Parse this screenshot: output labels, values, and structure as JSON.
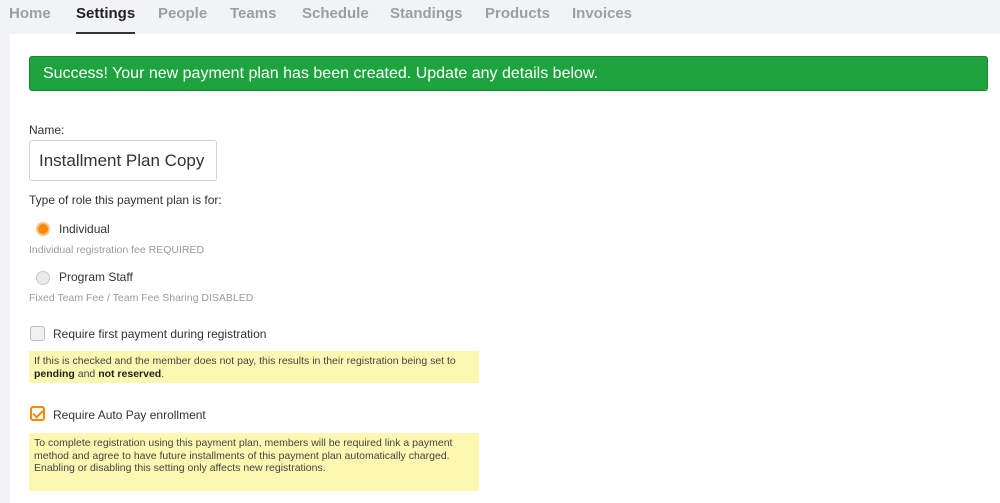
{
  "nav": {
    "tabs": [
      {
        "label": "Home",
        "active": false
      },
      {
        "label": "Settings",
        "active": true
      },
      {
        "label": "People",
        "active": false
      },
      {
        "label": "Teams",
        "active": false
      },
      {
        "label": "Schedule",
        "active": false
      },
      {
        "label": "Standings",
        "active": false
      },
      {
        "label": "Products",
        "active": false
      },
      {
        "label": "Invoices",
        "active": false
      }
    ]
  },
  "banner": {
    "text": "Success! Your new payment plan has been created. Update any details below.",
    "color": "#1ea43e"
  },
  "form": {
    "name_label": "Name:",
    "name_value": "Installment Plan Copy",
    "role_label": "Type of role this payment plan is for:",
    "roles": [
      {
        "label": "Individual",
        "hint": "Individual registration fee REQUIRED",
        "selected": true
      },
      {
        "label": "Program Staff",
        "hint": "Fixed Team Fee / Team Fee Sharing DISABLED",
        "selected": false
      }
    ],
    "first_payment": {
      "label": "Require first payment during registration",
      "checked": false,
      "note_part1": "If this is checked and the member does not pay, this results in their registration being set to ",
      "note_bold1": "pending",
      "note_part2": " and ",
      "note_bold2": "not reserved",
      "note_part3": "."
    },
    "auto_pay": {
      "label": "Require Auto Pay enrollment",
      "checked": true,
      "note": "To complete registration using this payment plan, members will be required link a payment method and agree to have future installments of this payment plan automatically charged. Enabling or disabling this setting only affects new registrations."
    }
  },
  "colors": {
    "accent": "#f58a07",
    "note_bg": "#fcf8b2"
  }
}
